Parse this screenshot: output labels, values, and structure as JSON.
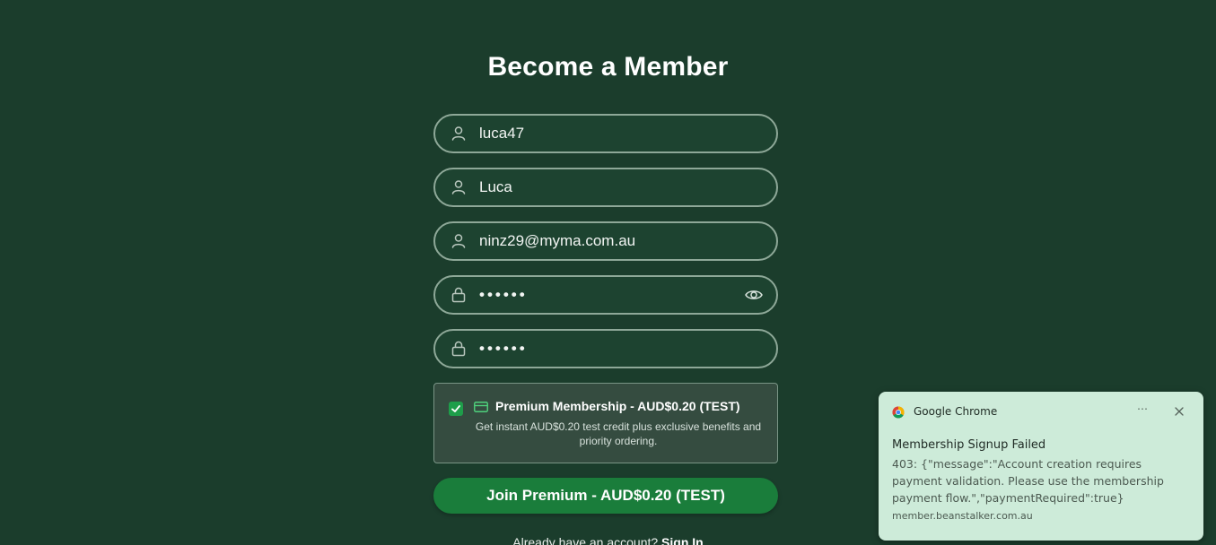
{
  "page": {
    "title": "Become a Member",
    "background_color": "#1b3d2c"
  },
  "form": {
    "username": {
      "value": "luca47",
      "icon": "user-icon"
    },
    "first_name": {
      "value": "Luca",
      "icon": "user-icon"
    },
    "email": {
      "value": "ninz29@myma.com.au",
      "icon": "user-icon"
    },
    "password": {
      "value": "••••••",
      "icon": "lock-icon",
      "toggle_icon": "eye-icon"
    },
    "confirm_password": {
      "value": "••••••",
      "icon": "lock-icon"
    }
  },
  "premium": {
    "checked": true,
    "icon": "credit-card-icon",
    "title": "Premium Membership - AUD$0.20 (TEST)",
    "description": "Get instant AUD$0.20 test credit plus exclusive benefits and priority ordering."
  },
  "join_button": {
    "label": "Join Premium - AUD$0.20 (TEST)",
    "color": "#1a7d3b"
  },
  "signin": {
    "prompt": "Already have an account?",
    "link_label": "Sign In"
  },
  "notification": {
    "app_name": "Google Chrome",
    "title": "Membership Signup Failed",
    "body": "403: {\"message\":\"Account creation requires payment validation. Please use the membership payment flow.\",\"paymentRequired\":true}",
    "source": "member.beanstalker.com.au",
    "more_icon": "more-icon",
    "close_icon": "close-icon",
    "background_color": "#cdebd9"
  }
}
